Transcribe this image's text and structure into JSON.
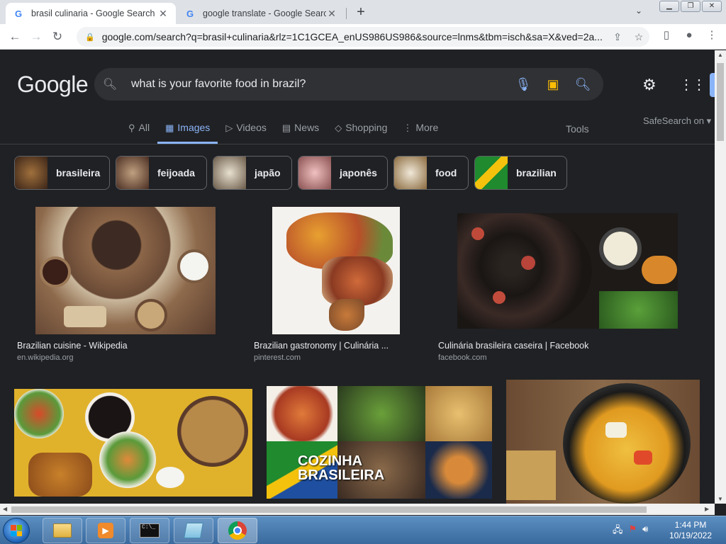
{
  "browser": {
    "tabs": [
      {
        "title": "brasil culinaria - Google Search",
        "favicon": "G"
      },
      {
        "title": "google translate - Google Search",
        "favicon": "G"
      }
    ],
    "new_tab_symbol": "+",
    "url": "google.com/search?q=brasil+culinaria&rlz=1C1GCEA_enUS986US986&source=lnms&tbm=isch&sa=X&ved=2a..."
  },
  "google": {
    "logo": "Google",
    "query": "what is your favorite food in brazil?",
    "nav_tabs": [
      {
        "label": "All",
        "icon": "search-icon"
      },
      {
        "label": "Images",
        "icon": "image-icon"
      },
      {
        "label": "Videos",
        "icon": "video-icon"
      },
      {
        "label": "News",
        "icon": "news-icon"
      },
      {
        "label": "Shopping",
        "icon": "tag-icon"
      },
      {
        "label": "More",
        "icon": "more-vert-icon"
      }
    ],
    "tools_label": "Tools",
    "safesearch_label": "SafeSearch on",
    "chips": [
      {
        "label": "brasileira",
        "color": "#5a3b2e"
      },
      {
        "label": "feijoada",
        "color": "#6b4a3a"
      },
      {
        "label": "japão",
        "color": "#7d6a55"
      },
      {
        "label": "japonês",
        "color": "#b38a8a"
      },
      {
        "label": "food",
        "color": "#8a7a5e"
      },
      {
        "label": "brazilian",
        "color": "#3c8a3c"
      }
    ],
    "results": [
      {
        "title": "Brazilian cuisine - Wikipedia",
        "source": "en.wikipedia.org",
        "color": "#7a5a44"
      },
      {
        "title": "Brazilian gastronomy | Culinária ...",
        "source": "pinterest.com",
        "color": "#f4f2ee"
      },
      {
        "title": "Culinária brasileira caseira | Facebook",
        "source": "facebook.com",
        "color": "#2a2220"
      },
      {
        "title": "",
        "source": "",
        "color": "#e0b22c"
      },
      {
        "title": "",
        "source": "",
        "color": "#9a3b2a"
      },
      {
        "title": "",
        "source": "",
        "color": "#8a6a4a"
      }
    ],
    "overlay_text": [
      "COZINHA",
      "BRASILEIRA"
    ]
  },
  "taskbar": {
    "time": "1:44 PM",
    "date": "10/19/2022"
  }
}
